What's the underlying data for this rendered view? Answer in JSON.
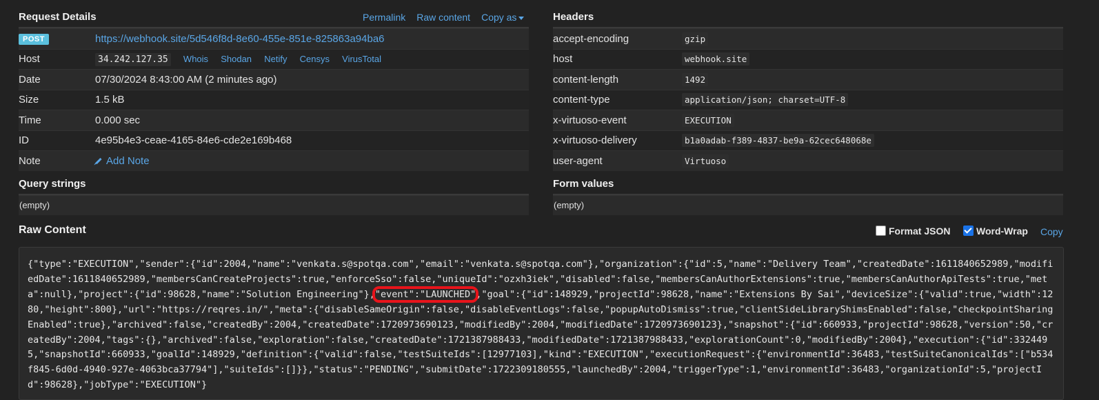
{
  "request_details": {
    "title": "Request Details",
    "links": {
      "permalink": "Permalink",
      "raw_content": "Raw content",
      "copy_as": "Copy as"
    },
    "method": "POST",
    "url": "https://webhook.site/5d546f8d-8e60-455e-851e-825863a94ba6",
    "host_label": "Host",
    "host_value": "34.242.127.35",
    "host_links": [
      "Whois",
      "Shodan",
      "Netify",
      "Censys",
      "VirusTotal"
    ],
    "date_label": "Date",
    "date_value": "07/30/2024 8:43:00 AM (2 minutes ago)",
    "size_label": "Size",
    "size_value": "1.5 kB",
    "time_label": "Time",
    "time_value": "0.000 sec",
    "id_label": "ID",
    "id_value": "4e95b4e3-ceae-4165-84e6-cde2e169b468",
    "note_label": "Note",
    "note_action": "Add Note"
  },
  "headers": {
    "title": "Headers",
    "rows": [
      {
        "key": "accept-encoding",
        "value": "gzip"
      },
      {
        "key": "host",
        "value": "webhook.site"
      },
      {
        "key": "content-length",
        "value": "1492"
      },
      {
        "key": "content-type",
        "value": "application/json; charset=UTF-8"
      },
      {
        "key": "x-virtuoso-event",
        "value": "EXECUTION"
      },
      {
        "key": "x-virtuoso-delivery",
        "value": "b1a0adab-f389-4837-be9a-62cec648068e"
      },
      {
        "key": "user-agent",
        "value": "Virtuoso"
      }
    ]
  },
  "query_strings": {
    "title": "Query strings",
    "value": "(empty)"
  },
  "form_values": {
    "title": "Form values",
    "value": "(empty)"
  },
  "raw": {
    "title": "Raw Content",
    "format_json_label": "Format JSON",
    "word_wrap_label": "Word-Wrap",
    "copy_label": "Copy",
    "text_before": "{\"type\":\"EXECUTION\",\"sender\":{\"id\":2004,\"name\":\"venkata.s@spotqa.com\",\"email\":\"venkata.s@spotqa.com\"},\"organization\":{\"id\":5,\"name\":\"Delivery Team\",\"createdDate\":1611840652989,\"modifiedDate\":1611840652989,\"membersCanCreateProjects\":true,\"enforceSso\":false,\"uniqueId\":\"ozxh3iek\",\"disabled\":false,\"membersCanAuthorExtensions\":true,\"membersCanAuthorApiTests\":true,\"meta\":null},\"project\":{\"id\":98628,\"name\":\"Solution Engineering\"},",
    "text_highlight": "\"event\":\"LAUNCHED\"",
    "text_after": ",\"goal\":{\"id\":148929,\"projectId\":98628,\"name\":\"Extensions By Sai\",\"deviceSize\":{\"valid\":true,\"width\":1280,\"height\":800},\"url\":\"https://reqres.in/\",\"meta\":{\"disableSameOrigin\":false,\"disableEventLogs\":false,\"popupAutoDismiss\":true,\"clientSideLibraryShimsEnabled\":false,\"checkpointSharingEnabled\":true},\"archived\":false,\"createdBy\":2004,\"createdDate\":1720973690123,\"modifiedBy\":2004,\"modifiedDate\":1720973690123},\"snapshot\":{\"id\":660933,\"projectId\":98628,\"version\":50,\"createdBy\":2004,\"tags\":{},\"archived\":false,\"exploration\":false,\"createdDate\":1721387988433,\"modifiedDate\":1721387988433,\"explorationCount\":0,\"modifiedBy\":2004},\"execution\":{\"id\":3324495,\"snapshotId\":660933,\"goalId\":148929,\"definition\":{\"valid\":false,\"testSuiteIds\":[12977103],\"kind\":\"EXECUTION\",\"executionRequest\":{\"environmentId\":36483,\"testSuiteCanonicalIds\":[\"b534f845-6d0d-4940-927e-4063bca37794\"],\"suiteIds\":[]}},\"status\":\"PENDING\",\"submitDate\":1722309180555,\"launchedBy\":2004,\"triggerType\":1,\"environmentId\":36483,\"organizationId\":5,\"projectId\":98628},\"jobType\":\"EXECUTION\"}"
  }
}
